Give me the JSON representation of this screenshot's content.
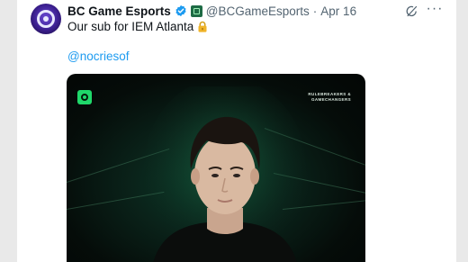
{
  "tweet": {
    "author_name": "BC Game Esports",
    "handle": "@BCGameEsports",
    "separator": "·",
    "date": "Apr 16",
    "text": "Our sub for IEM Atlanta",
    "mention": "@nocriesof"
  },
  "media": {
    "tagline_line1": "RULEBREAKERS &",
    "tagline_line2": "GAMECHANGERS"
  },
  "icons": [
    "bc-game-avatar-icon",
    "verified-badge-icon",
    "affiliate-badge-icon",
    "grok-icon",
    "more-icon",
    "lock-icon"
  ],
  "colors": {
    "link": "#1d9bf0",
    "verified": "#1d9bf0",
    "text": "#0f1419",
    "muted": "#536471",
    "brand_green": "#1fd86a"
  }
}
